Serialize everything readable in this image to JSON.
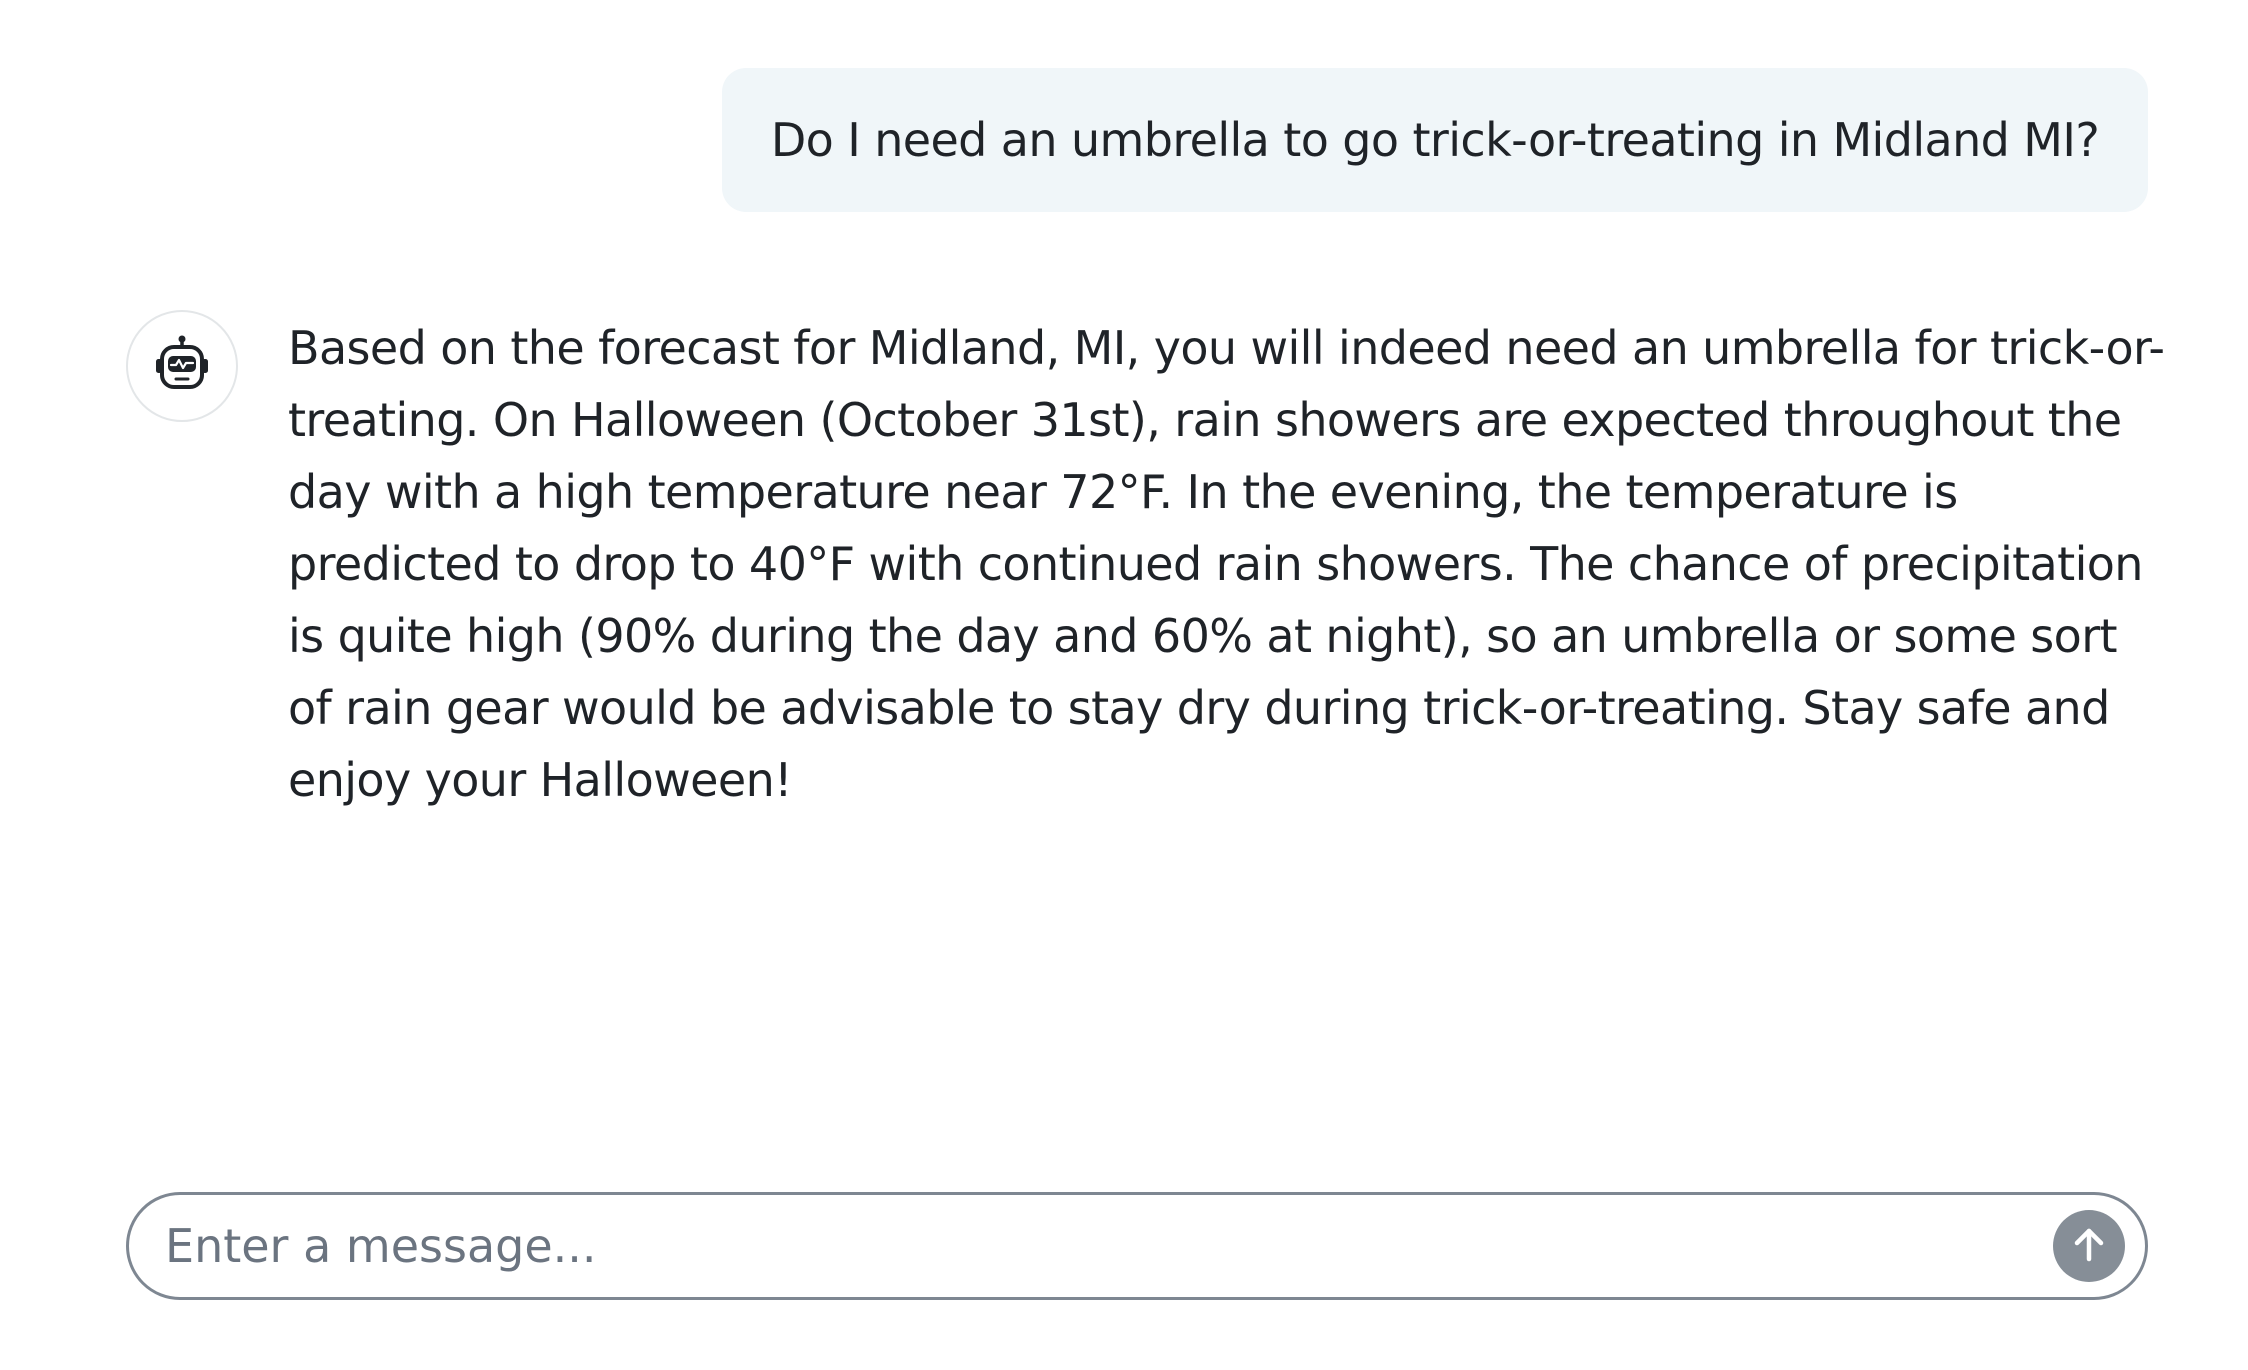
{
  "conversation": {
    "user_message": "Do I need an umbrella to go trick-or-treating in Midland MI?",
    "assistant_message": "Based on the forecast for Midland, MI, you will indeed need an umbrella for trick-or-treating. On Halloween (October 31st), rain showers are expected throughout the day with a high temperature near 72°F. In the evening, the temperature is predicted to drop to 40°F with continued rain showers. The chance of precipitation is quite high (90% during the day and 60% at night), so an umbrella or some sort of rain gear would be advisable to stay dry during trick-or-treating. Stay safe and enjoy your Halloween!",
    "assistant_avatar_icon": "robot-icon"
  },
  "composer": {
    "value": "",
    "placeholder": "Enter a message...",
    "send_icon": "arrow-up-icon"
  },
  "colors": {
    "user_bubble_bg": "#f0f6f9",
    "composer_border": "#7e8792",
    "send_button_bg": "#868e97",
    "text": "#1f2328",
    "placeholder": "#6b7480"
  }
}
